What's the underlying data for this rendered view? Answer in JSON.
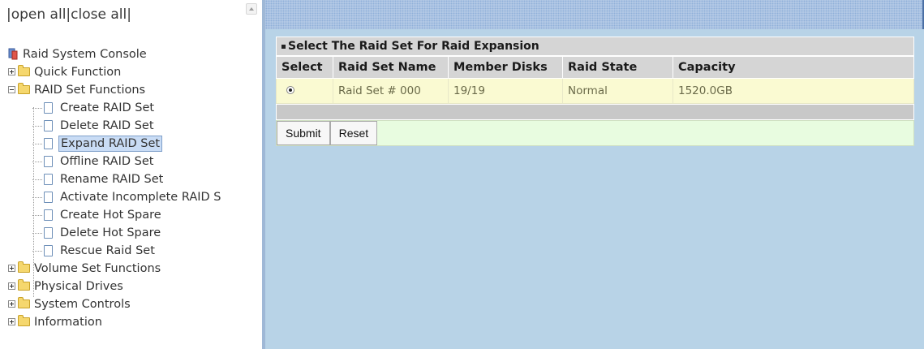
{
  "left_header": {
    "open_all": "|open all",
    "close_all": "|close all|"
  },
  "tree": {
    "root_label": "Raid System Console",
    "quick_function": "Quick Function",
    "raid_set_functions": "RAID Set Functions",
    "raid_items": [
      "Create RAID Set",
      "Delete RAID Set",
      "Expand RAID Set",
      "Offline RAID Set",
      "Rename RAID Set",
      "Activate Incomplete RAID S",
      "Create Hot Spare",
      "Delete Hot Spare",
      "Rescue Raid Set"
    ],
    "active_item": "Expand RAID Set",
    "volume_set_functions": "Volume Set Functions",
    "physical_drives": "Physical Drives",
    "system_controls": "System Controls",
    "information": "Information"
  },
  "panel": {
    "title": "Select The Raid Set For Raid Expansion",
    "columns": [
      "Select",
      "Raid Set Name",
      "Member Disks",
      "Raid State",
      "Capacity"
    ],
    "row": {
      "name": "Raid Set # 000",
      "member_disks": "19/19",
      "raid_state": "Normal",
      "capacity": "1520.0GB",
      "selected": true
    },
    "submit_label": "Submit",
    "reset_label": "Reset"
  },
  "colors": {
    "main_bg": "#b8d3e7",
    "row_bg": "#fafad2",
    "button_row_bg": "#e8fce0",
    "header_gray": "#d5d5d5"
  }
}
